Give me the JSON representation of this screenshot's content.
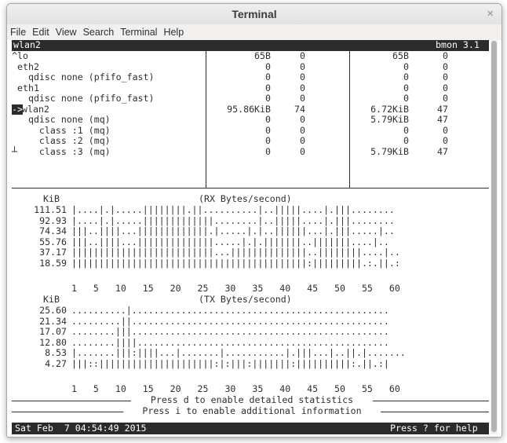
{
  "window": {
    "title": "Terminal",
    "close_glyph": "×"
  },
  "menu": [
    "File",
    "Edit",
    "View",
    "Search",
    "Terminal",
    "Help"
  ],
  "header": {
    "left": "wlan2",
    "right": "bmon 3.1"
  },
  "interfaces": [
    {
      "marker": "^",
      "name": "lo",
      "rx_bytes": "65B",
      "rx_pkts": "0",
      "tx_bytes": "65B",
      "tx_pkts": "0"
    },
    {
      "marker": "",
      "name": "eth2",
      "rx_bytes": "0",
      "rx_pkts": "0",
      "tx_bytes": "0",
      "tx_pkts": "0"
    },
    {
      "marker": "",
      "name": "  qdisc none (pfifo_fast)",
      "rx_bytes": "0",
      "rx_pkts": "0",
      "tx_bytes": "0",
      "tx_pkts": "0"
    },
    {
      "marker": "",
      "name": "eth1",
      "rx_bytes": "0",
      "rx_pkts": "0",
      "tx_bytes": "0",
      "tx_pkts": "0"
    },
    {
      "marker": "",
      "name": "  qdisc none (pfifo_fast)",
      "rx_bytes": "0",
      "rx_pkts": "0",
      "tx_bytes": "0",
      "tx_pkts": "0"
    },
    {
      "marker": "->",
      "name": "wlan2",
      "rx_bytes": "95.86KiB",
      "rx_pkts": "74",
      "tx_bytes": "6.72KiB",
      "tx_pkts": "47"
    },
    {
      "marker": "",
      "name": "  qdisc none (mq)",
      "rx_bytes": "0",
      "rx_pkts": "0",
      "tx_bytes": "5.79KiB",
      "tx_pkts": "47"
    },
    {
      "marker": "",
      "name": "    class :1 (mq)",
      "rx_bytes": "0",
      "rx_pkts": "0",
      "tx_bytes": "0",
      "tx_pkts": "0"
    },
    {
      "marker": "",
      "name": "    class :2 (mq)",
      "rx_bytes": "0",
      "rx_pkts": "0",
      "tx_bytes": "0",
      "tx_pkts": "0"
    },
    {
      "marker": "┴",
      "name": "    class :3 (mq)",
      "rx_bytes": "0",
      "rx_pkts": "0",
      "tx_bytes": "5.79KiB",
      "tx_pkts": "47"
    }
  ],
  "rx_graph": {
    "unit": "KiB",
    "title": "(RX Bytes/second)",
    "ylabels": [
      "111.51",
      "92.93",
      "74.34",
      "55.76",
      "37.17",
      "18.59"
    ],
    "rows": [
      "|....|.|.....||||||||.||..........|..|||||....|.|||........",
      "|....|.|.....|||||||||||||........|..|||||....|.|||........",
      "|||..||||...|||||||||||||.|.....|.|..||||||...|.|||.....|..",
      "|||..||||...||||||||||||||.....|.|.|||||||..|||||||....|..",
      "||||||||||||||||||||||||||...||||||||||||||..||||||||....|..",
      "|||||||||||||||||||||||||||||||||||||||||||:|||||||||.:.||.:"
    ],
    "xaxis": "1   5   10   15   20   25   30   35   40   45   50   55   60"
  },
  "tx_graph": {
    "unit": "KiB",
    "title": "(TX Bytes/second)",
    "ylabels": [
      "25.60",
      "21.34",
      "17.07",
      "12.80",
      "8.53",
      "4.27"
    ],
    "rows": [
      "..........|...............................................",
      ".........||...............................................",
      "........|||...............................................",
      "........||||..............................................",
      "|.......|||:||||...|.......|...........|.|||...|..||.|.......",
      "|||::|||||||||||||||||||||:|:|||:|||||||:||||||||||:.||.:|"
    ],
    "xaxis": "1   5   10   15   20   25   30   35   40   45   50   55   60"
  },
  "messages": [
    "Press d to enable detailed statistics",
    "Press i to enable additional information"
  ],
  "footer": {
    "left": "Sat Feb  7 04:54:49 2015",
    "right": "Press ? for help"
  },
  "colors": {
    "terminal_bg": "#ffffff",
    "terminal_fg": "#2f2f2f",
    "bar_bg": "#2b2b2b"
  }
}
